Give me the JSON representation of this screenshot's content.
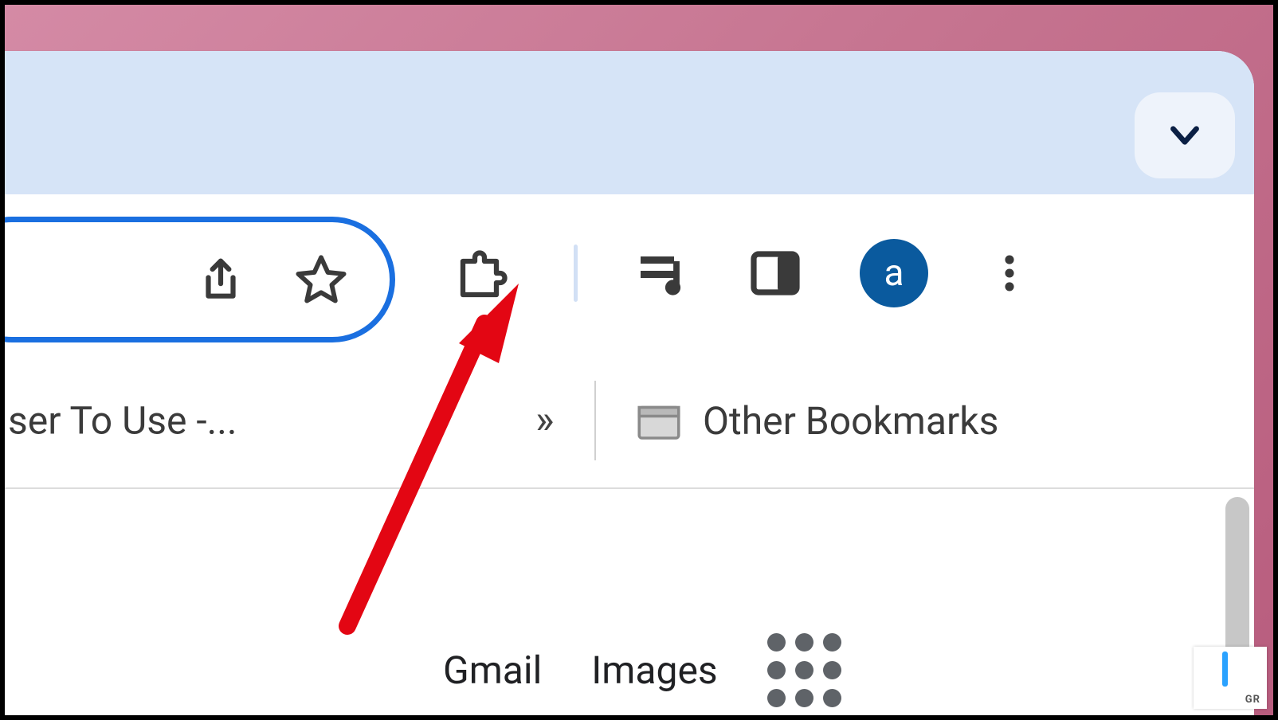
{
  "tabstrip": {
    "chevron_icon": "chevron-down"
  },
  "omnibox": {
    "share_icon": "share",
    "bookmark_icon": "star"
  },
  "toolbar": {
    "extensions_icon": "puzzle-piece",
    "media_icon": "media-playlist",
    "sidepanel_icon": "side-panel",
    "profile_letter": "a",
    "menu_icon": "vertical-dots"
  },
  "bookmarks": {
    "truncated_item": "ser To Use -...",
    "overflow_glyph": "»",
    "other_label": "Other Bookmarks",
    "folder_icon": "folder"
  },
  "content": {
    "links": {
      "gmail": "Gmail",
      "images": "Images",
      "apps_icon": "apps-grid"
    }
  },
  "annotation": {
    "arrow_color": "#e30613"
  },
  "corner_badge": {
    "text": "GR"
  }
}
